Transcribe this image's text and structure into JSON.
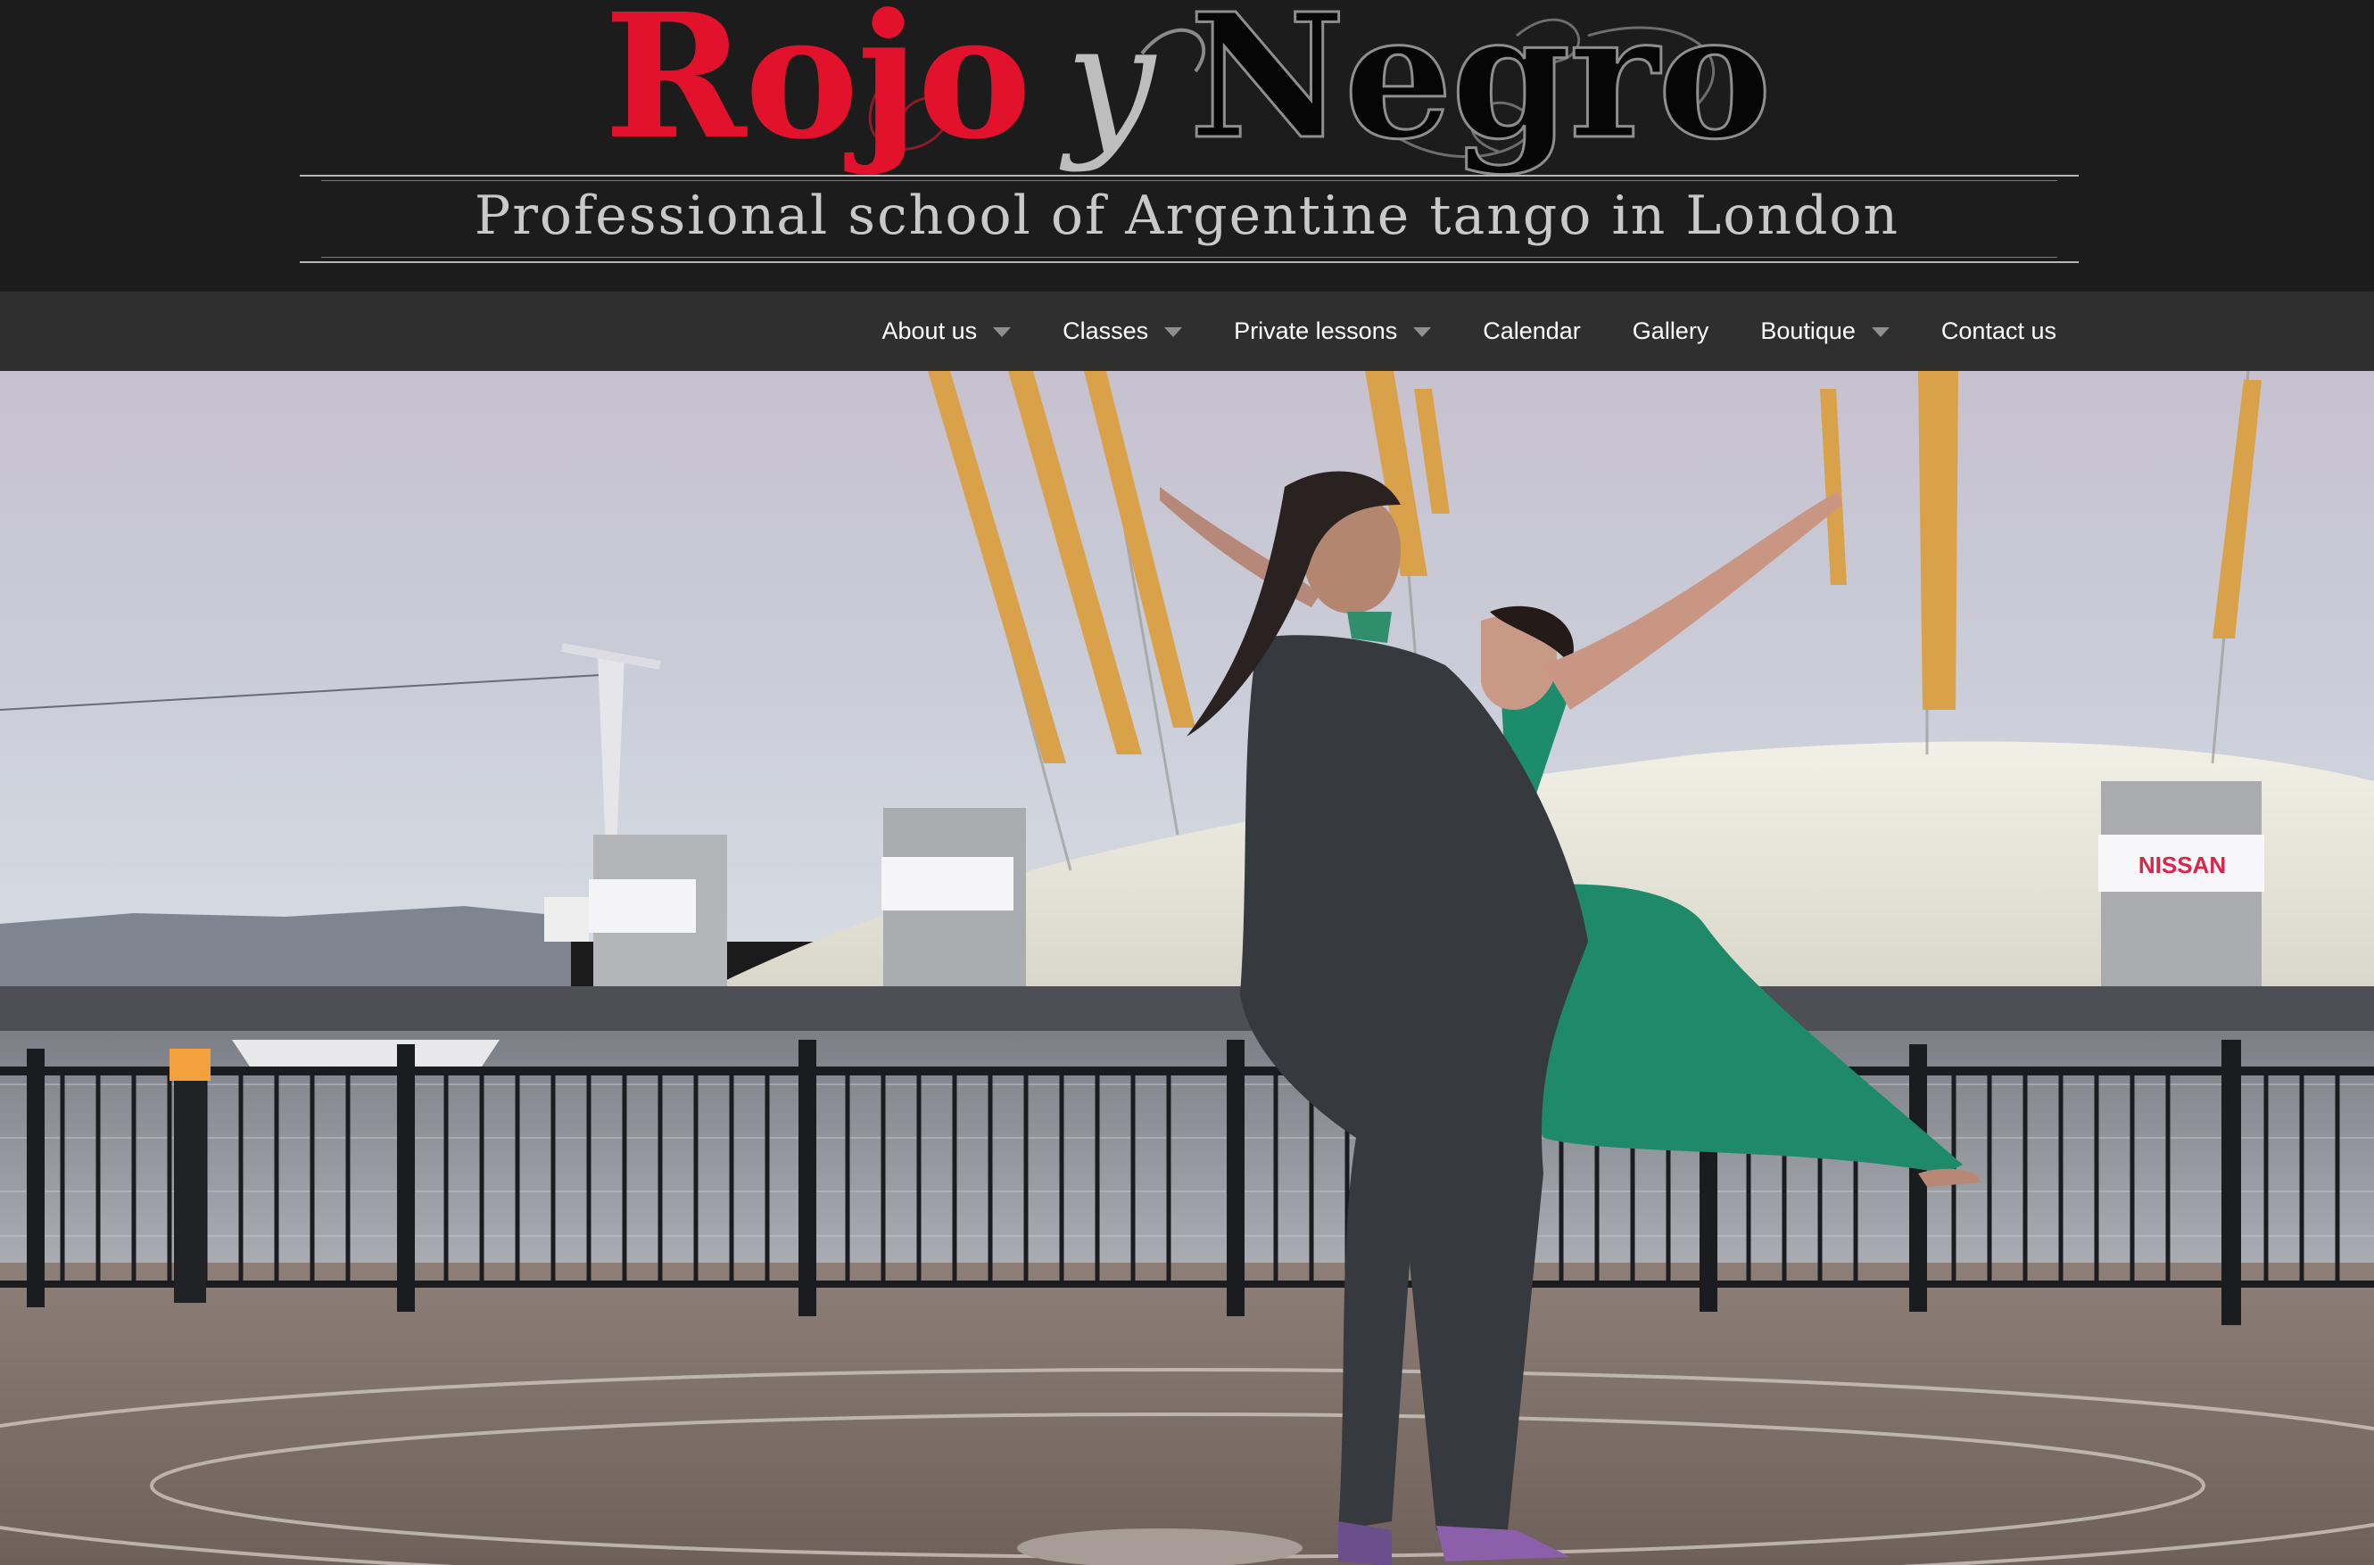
{
  "logo": {
    "word1": "Rojo",
    "word2": "y",
    "word3": "Negro"
  },
  "tagline": "Professional school of Argentine tango in London",
  "nav": {
    "items": [
      {
        "label": "About us",
        "has_dropdown": true
      },
      {
        "label": "Classes",
        "has_dropdown": true
      },
      {
        "label": "Private lessons",
        "has_dropdown": true
      },
      {
        "label": "Calendar",
        "has_dropdown": false
      },
      {
        "label": "Gallery",
        "has_dropdown": false
      },
      {
        "label": "Boutique",
        "has_dropdown": true
      },
      {
        "label": "Contact us",
        "has_dropdown": false
      }
    ]
  },
  "hero": {
    "sign_text": "NISSAN"
  },
  "colors": {
    "brand_red": "#e2122c",
    "header_bg": "#1c1c1c",
    "nav_bg": "#2f2f2f",
    "nav_text": "#ffffff",
    "tagline_text": "#c9c9c9"
  }
}
